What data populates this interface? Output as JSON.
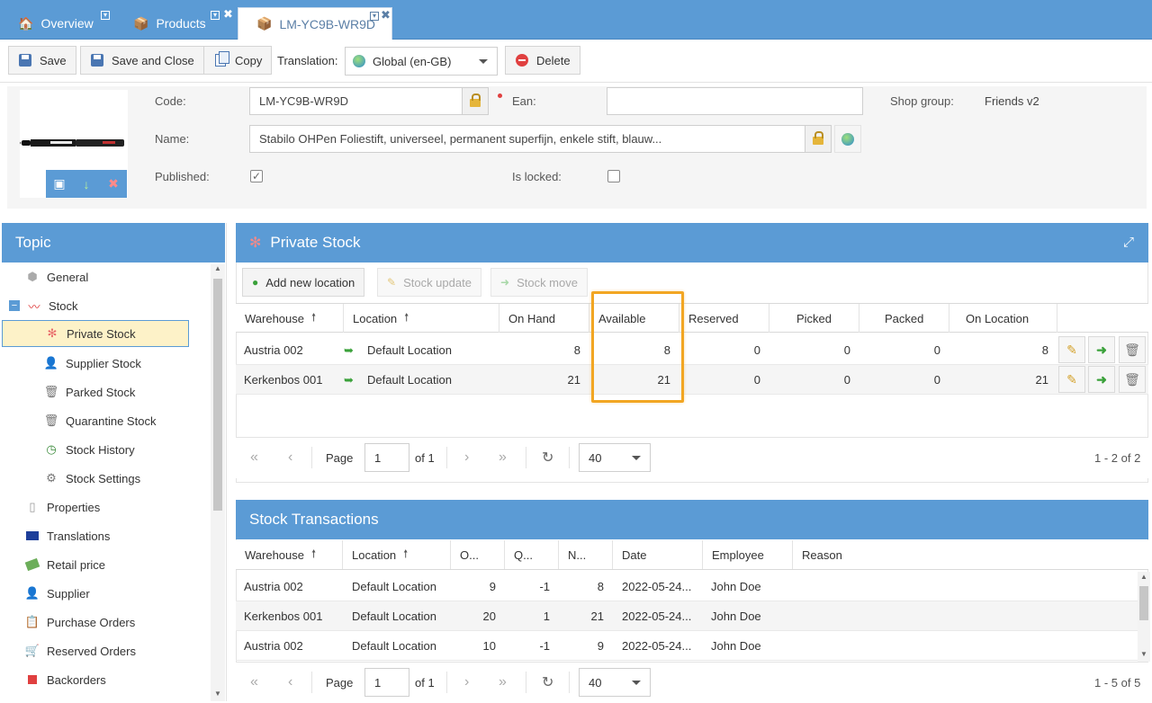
{
  "tabs": [
    {
      "label": "Overview",
      "icon": "home-icon"
    },
    {
      "label": "Products",
      "icon": "box-icon"
    },
    {
      "label": "LM-YC9B-WR9D",
      "icon": "box-icon"
    }
  ],
  "toolbar": {
    "save_label": "Save",
    "save_close_label": "Save and Close",
    "copy_label": "Copy",
    "translation_label": "Translation:",
    "translation_value": "Global (en-GB)",
    "delete_label": "Delete"
  },
  "product": {
    "code_label": "Code:",
    "code_value": "LM-YC9B-WR9D",
    "ean_label": "Ean:",
    "ean_value": "",
    "shop_group_label": "Shop group:",
    "shop_group_value": "Friends v2",
    "name_label": "Name:",
    "name_value": "Stabilo OHPen Foliestift, universeel, permanent superfijn, enkele stift, blauw...",
    "published_label": "Published:",
    "published": true,
    "is_locked_label": "Is locked:",
    "is_locked": false
  },
  "topic": {
    "title": "Topic",
    "items": [
      {
        "label": "General",
        "icon": "cube-icon"
      },
      {
        "label": "Stock",
        "icon": "chart-icon"
      },
      {
        "label": "Private Stock",
        "icon": "asterisk-icon"
      },
      {
        "label": "Supplier Stock",
        "icon": "person-icon"
      },
      {
        "label": "Parked Stock",
        "icon": "bin-icon"
      },
      {
        "label": "Quarantine Stock",
        "icon": "bin-icon"
      },
      {
        "label": "Stock History",
        "icon": "clock-icon"
      },
      {
        "label": "Stock Settings",
        "icon": "gear-icon"
      },
      {
        "label": "Properties",
        "icon": "document-icon"
      },
      {
        "label": "Translations",
        "icon": "flag-icon"
      },
      {
        "label": "Retail price",
        "icon": "money-icon"
      },
      {
        "label": "Supplier",
        "icon": "person-icon"
      },
      {
        "label": "Purchase Orders",
        "icon": "order-icon"
      },
      {
        "label": "Reserved Orders",
        "icon": "cart-icon"
      },
      {
        "label": "Backorders",
        "icon": "square-icon"
      }
    ]
  },
  "private_stock": {
    "title": "Private Stock",
    "add_label": "Add new location",
    "update_label": "Stock update",
    "move_label": "Stock move",
    "columns": [
      "Warehouse",
      "Location",
      "On Hand",
      "Available",
      "Reserved",
      "Picked",
      "Packed",
      "On Location"
    ],
    "rows": [
      {
        "warehouse": "Austria 002",
        "location": "Default Location",
        "on_hand": "8",
        "available": "8",
        "reserved": "0",
        "picked": "0",
        "packed": "0",
        "on_location": "8"
      },
      {
        "warehouse": "Kerkenbos 001",
        "location": "Default Location",
        "on_hand": "21",
        "available": "21",
        "reserved": "0",
        "picked": "0",
        "packed": "0",
        "on_location": "21"
      }
    ],
    "pager": {
      "page_label": "Page",
      "page": "1",
      "of_label": "of 1",
      "size": "40",
      "summary": "1 - 2 of 2"
    }
  },
  "transactions": {
    "title": "Stock Transactions",
    "columns": [
      "Warehouse",
      "Location",
      "O...",
      "Q...",
      "N...",
      "Date",
      "Employee",
      "Reason"
    ],
    "rows": [
      {
        "warehouse": "Austria 002",
        "location": "Default Location",
        "o": "9",
        "q": "-1",
        "n": "8",
        "date": "2022-05-24...",
        "employee": "John Doe",
        "reason": ""
      },
      {
        "warehouse": "Kerkenbos 001",
        "location": "Default Location",
        "o": "20",
        "q": "1",
        "n": "21",
        "date": "2022-05-24...",
        "employee": "John Doe",
        "reason": ""
      },
      {
        "warehouse": "Austria 002",
        "location": "Default Location",
        "o": "10",
        "q": "-1",
        "n": "9",
        "date": "2022-05-24...",
        "employee": "John Doe",
        "reason": ""
      }
    ],
    "pager": {
      "page_label": "Page",
      "page": "1",
      "of_label": "of 1",
      "size": "40",
      "summary": "1 - 5 of 5"
    }
  },
  "colors": {
    "accent": "#5b9bd5",
    "highlight": "#f2a623",
    "selected_bg": "#fdf2c8"
  }
}
